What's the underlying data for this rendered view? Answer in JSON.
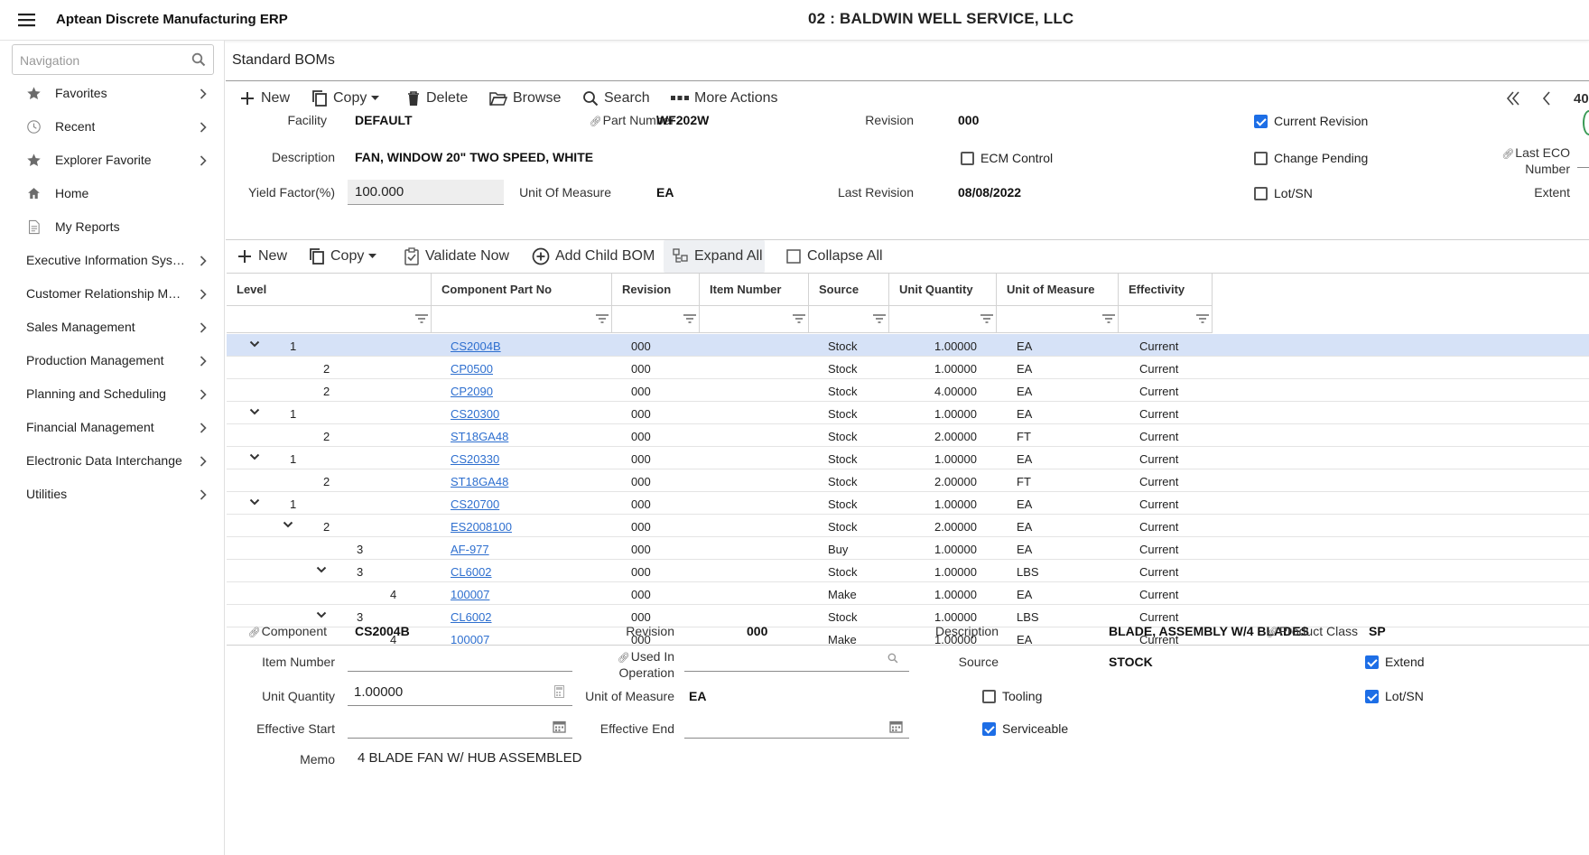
{
  "app": {
    "title": "Aptean Discrete Manufacturing ERP",
    "company": "02 : BALDWIN WELL SERVICE, LLC"
  },
  "sidebar": {
    "search_placeholder": "Navigation",
    "items": [
      {
        "label": "Favorites",
        "icon": "star-icon"
      },
      {
        "label": "Recent",
        "icon": "clock-icon"
      },
      {
        "label": "Explorer Favorite",
        "icon": "star-icon"
      },
      {
        "label": "Home",
        "icon": "home-icon"
      },
      {
        "label": "My Reports",
        "icon": "report-icon"
      },
      {
        "label": "Executive Information Syst..."
      },
      {
        "label": "Customer Relationship Ma..."
      },
      {
        "label": "Sales Management"
      },
      {
        "label": "Production Management"
      },
      {
        "label": "Planning and Scheduling"
      },
      {
        "label": "Financial Management"
      },
      {
        "label": "Electronic Data Interchange"
      },
      {
        "label": "Utilities"
      }
    ]
  },
  "page": {
    "title": "Standard BOMs"
  },
  "toolbar": {
    "new": "New",
    "copy": "Copy",
    "delete": "Delete",
    "browse": "Browse",
    "search": "Search",
    "more": "More Actions",
    "page_fragment": "40"
  },
  "header": {
    "facility_label": "Facility",
    "facility": "DEFAULT",
    "part_label": "Part Number",
    "part": "WF202W",
    "revision_label": "Revision",
    "revision": "000",
    "current_revision_label": "Current Revision",
    "current_revision": true,
    "description_label": "Description",
    "description": "FAN, WINDOW 20\" TWO SPEED, WHITE",
    "ecm_label": "ECM Control",
    "ecm": false,
    "change_pending_label": "Change Pending",
    "change_pending": false,
    "last_eco_label_1": "Last ECO",
    "last_eco_label_2": "Number",
    "yield_label": "Yield Factor(%)",
    "yield": "100.000",
    "uom_label": "Unit Of Measure",
    "uom": "EA",
    "last_revision_label": "Last Revision",
    "last_revision": "08/08/2022",
    "lotsn_label": "Lot/SN",
    "lotsn": false,
    "extent_label": "Extent"
  },
  "grid_toolbar": {
    "new": "New",
    "copy": "Copy",
    "validate": "Validate Now",
    "add_child": "Add Child BOM",
    "expand": "Expand All",
    "collapse": "Collapse All"
  },
  "grid": {
    "columns": [
      "Level",
      "Component Part No",
      "Revision",
      "Item Number",
      "Source",
      "Unit Quantity",
      "Unit of Measure",
      "Effectivity"
    ],
    "rows": [
      {
        "level": "1",
        "expandable": true,
        "part": "CS2004B",
        "rev": "000",
        "item": "",
        "source": "Stock",
        "qty": "1.00000",
        "uom": "EA",
        "eff": "Current"
      },
      {
        "level": "2",
        "expandable": false,
        "part": "CP0500",
        "rev": "000",
        "item": "",
        "source": "Stock",
        "qty": "1.00000",
        "uom": "EA",
        "eff": "Current"
      },
      {
        "level": "2",
        "expandable": false,
        "part": "CP2090",
        "rev": "000",
        "item": "",
        "source": "Stock",
        "qty": "4.00000",
        "uom": "EA",
        "eff": "Current"
      },
      {
        "level": "1",
        "expandable": true,
        "part": "CS20300",
        "rev": "000",
        "item": "",
        "source": "Stock",
        "qty": "1.00000",
        "uom": "EA",
        "eff": "Current"
      },
      {
        "level": "2",
        "expandable": false,
        "part": "ST18GA48",
        "rev": "000",
        "item": "",
        "source": "Stock",
        "qty": "2.00000",
        "uom": "FT",
        "eff": "Current"
      },
      {
        "level": "1",
        "expandable": true,
        "part": "CS20330",
        "rev": "000",
        "item": "",
        "source": "Stock",
        "qty": "1.00000",
        "uom": "EA",
        "eff": "Current"
      },
      {
        "level": "2",
        "expandable": false,
        "part": "ST18GA48",
        "rev": "000",
        "item": "",
        "source": "Stock",
        "qty": "2.00000",
        "uom": "FT",
        "eff": "Current"
      },
      {
        "level": "1",
        "expandable": true,
        "part": "CS20700",
        "rev": "000",
        "item": "",
        "source": "Stock",
        "qty": "1.00000",
        "uom": "EA",
        "eff": "Current"
      },
      {
        "level": "2",
        "expandable": true,
        "part": "ES2008100",
        "rev": "000",
        "item": "",
        "source": "Stock",
        "qty": "2.00000",
        "uom": "EA",
        "eff": "Current"
      },
      {
        "level": "3",
        "expandable": false,
        "part": "AF-977",
        "rev": "000",
        "item": "",
        "source": "Buy",
        "qty": "1.00000",
        "uom": "EA",
        "eff": "Current"
      },
      {
        "level": "3",
        "expandable": true,
        "part": "CL6002",
        "rev": "000",
        "item": "",
        "source": "Stock",
        "qty": "1.00000",
        "uom": "LBS",
        "eff": "Current"
      },
      {
        "level": "4",
        "expandable": false,
        "part": "100007",
        "rev": "000",
        "item": "",
        "source": "Make",
        "qty": "1.00000",
        "uom": "EA",
        "eff": "Current"
      },
      {
        "level": "3",
        "expandable": true,
        "part": "CL6002",
        "rev": "000",
        "item": "",
        "source": "Stock",
        "qty": "1.00000",
        "uom": "LBS",
        "eff": "Current"
      },
      {
        "level": "4",
        "expandable": false,
        "part": "100007",
        "rev": "000",
        "item": "",
        "source": "Make",
        "qty": "1.00000",
        "uom": "EA",
        "eff": "Current"
      }
    ]
  },
  "detail": {
    "component_label": "Component",
    "component": "CS2004B",
    "revision_label": "Revision",
    "revision": "000",
    "description_label": "Description",
    "description": "BLADE, ASSEMBLY W/4 BLADES",
    "product_class_label": "Product Class",
    "product_class": "SP",
    "item_number_label": "Item Number",
    "item_number": "",
    "used_in_label_1": "Used In",
    "used_in_label_2": "Operation",
    "used_in": "",
    "source_label": "Source",
    "source": "STOCK",
    "extend_label": "Extend",
    "extend": true,
    "unit_qty_label": "Unit Quantity",
    "unit_qty": "1.00000",
    "uom_label": "Unit of Measure",
    "uom": "EA",
    "tooling_label": "Tooling",
    "tooling": false,
    "lotsn_label": "Lot/SN",
    "lotsn": true,
    "eff_start_label": "Effective Start",
    "eff_start": "",
    "eff_end_label": "Effective End",
    "eff_end": "",
    "serviceable_label": "Serviceable",
    "serviceable": true,
    "memo_label": "Memo",
    "memo": "4 BLADE FAN W/ HUB ASSEMBLED"
  }
}
